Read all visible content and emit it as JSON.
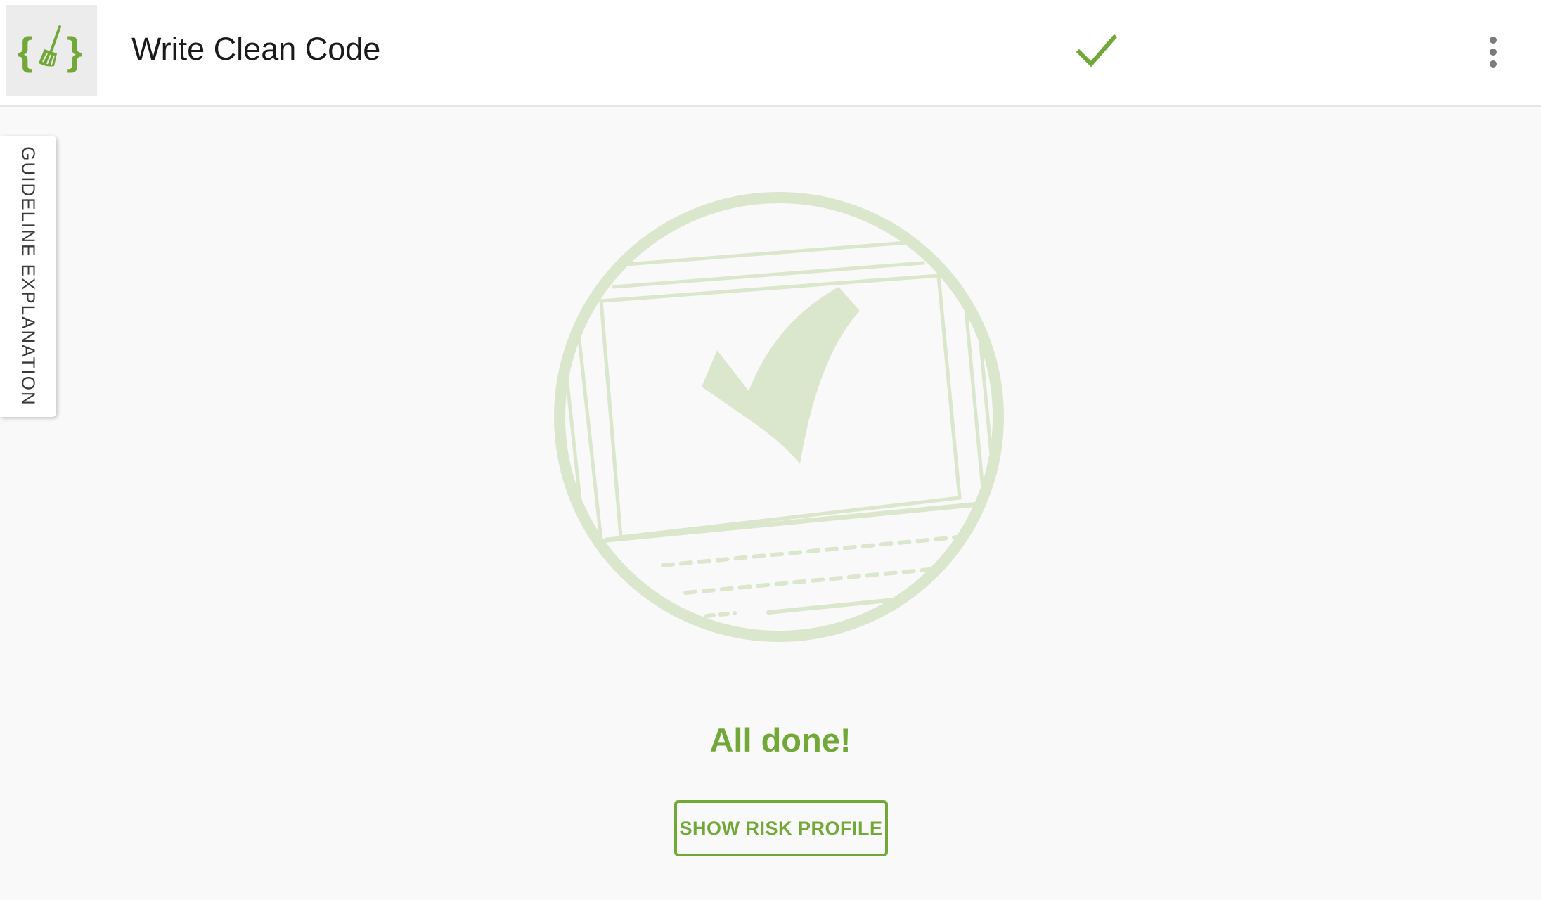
{
  "header": {
    "title": "Write Clean Code",
    "logo_icon": "curly-braces-broom-icon",
    "status_icon": "checkmark-icon",
    "menu_icon": "more-vertical-icon"
  },
  "side_tab": {
    "label": "GUIDELINE EXPLANATION"
  },
  "main": {
    "illustration_icon": "laptop-checkmark-icon",
    "status_message": "All done!",
    "risk_button_label": "SHOW RISK PROFILE"
  },
  "colors": {
    "accent": "#72a838",
    "illustration": "#dbe7cc",
    "background": "#f9f9f9",
    "header_bg": "#ffffff"
  }
}
